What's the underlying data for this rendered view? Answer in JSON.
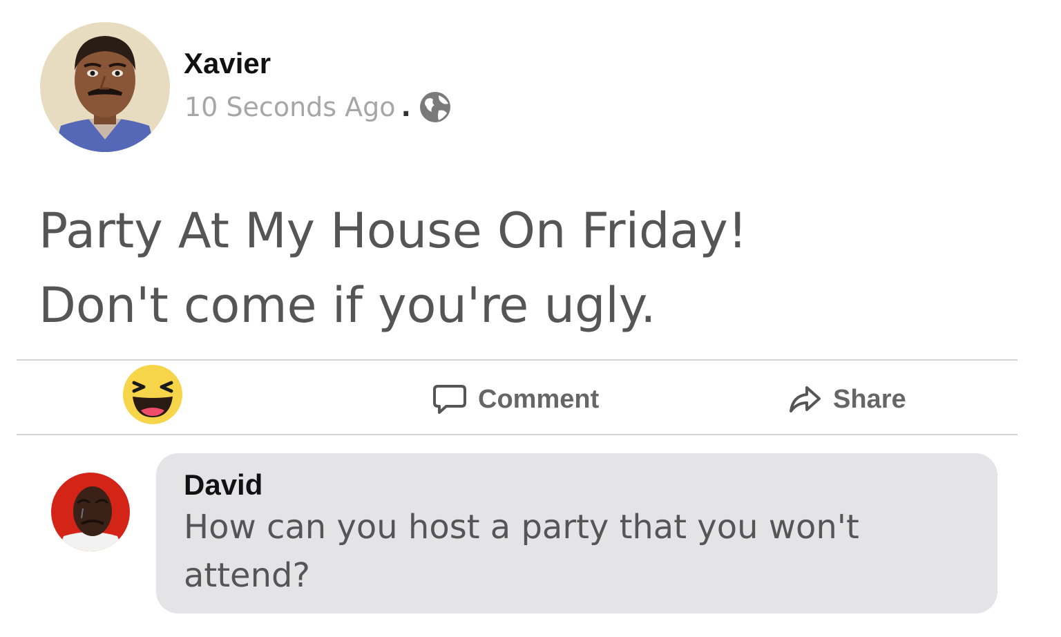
{
  "post": {
    "author": "Xavier",
    "timestamp": "10 Seconds Ago",
    "separator": ".",
    "privacy_icon": "globe-icon",
    "avatar_icon": "profile-photo",
    "text_lines": [
      "Party At My House On Friday!",
      "Don't come if you're ugly."
    ]
  },
  "actions": {
    "reaction_icon": "laughing-emoji-icon",
    "comment_label": "Comment",
    "comment_icon": "speech-bubble-icon",
    "share_label": "Share",
    "share_icon": "share-arrow-icon"
  },
  "comment": {
    "author": "David",
    "text": "How can you host a party that you won't attend?",
    "avatar_icon": "crying-face-photo"
  },
  "colors": {
    "divider": "#d4d4d4",
    "bubble": "#e4e4e6",
    "secondary_text": "#a6a6a6",
    "body_text": "#555555",
    "reaction_yellow": "#f7d54a"
  }
}
